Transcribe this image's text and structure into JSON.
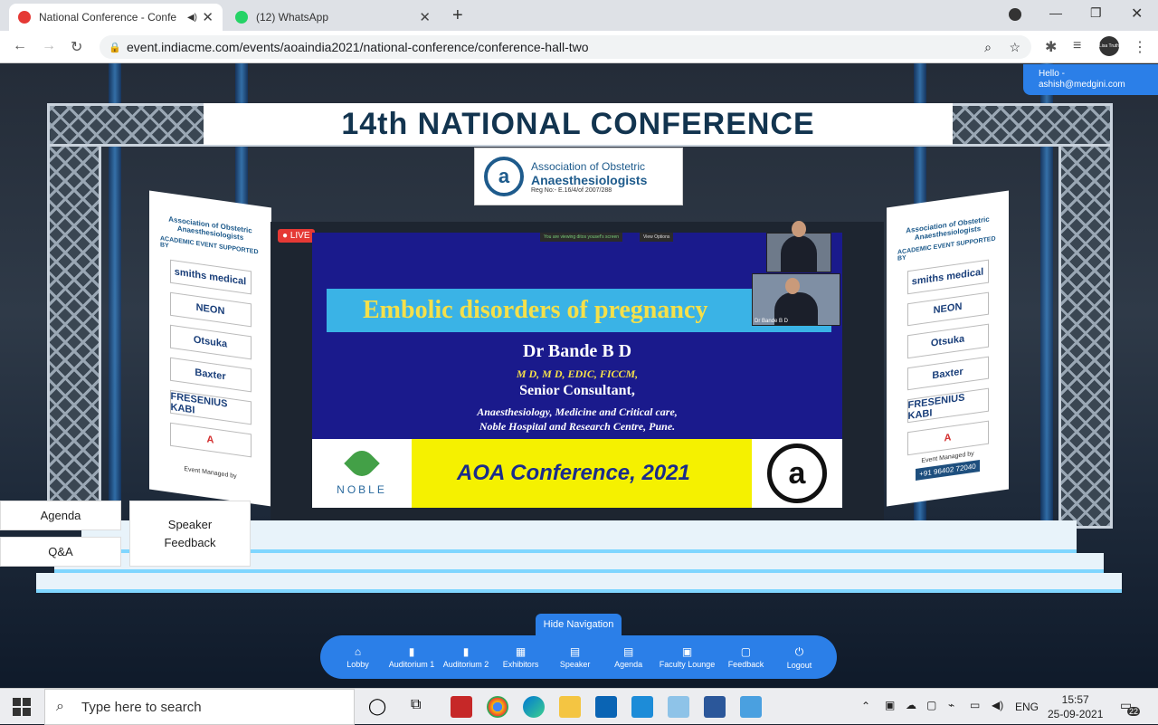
{
  "browser": {
    "tabs": [
      {
        "title": "National Conference - Confe",
        "active": true,
        "icon": "conference-favicon"
      },
      {
        "title": "(12) WhatsApp",
        "active": false,
        "icon": "whatsapp-favicon"
      }
    ],
    "url": "event.indiacme.com/events/aoaindia2021/national-conference/conference-hall-two",
    "profile_label": "Lisa Truth"
  },
  "user": {
    "greeting": "Hello -",
    "email": "ashish@medgini.com"
  },
  "stage": {
    "title": "14th NATIONAL CONFERENCE",
    "org": {
      "line1": "Association of Obstetric",
      "line2": "Anaesthesiologists",
      "line3": "Reg No:- E.16/4/of 2007/288",
      "logo_letter": "a"
    },
    "side_banner": {
      "org": "Association of Obstetric Anaesthesiologists",
      "supported": "ACADEMIC EVENT SUPPORTED BY",
      "sponsors": [
        "smiths medical",
        "NEON",
        "Otsuka",
        "Baxter",
        "FRESENIUS KABI",
        "A"
      ],
      "managed": "Event Managed by",
      "phone": "+91 96402 72040"
    }
  },
  "video": {
    "live_label": "LIVE",
    "share_notice": "You are viewing ditos yousef's screen",
    "view_options": "View Options",
    "cam_label": "Dr Bande B D",
    "slide": {
      "title": "Embolic disorders of pregnancy",
      "speaker": "Dr Bande B D",
      "degrees": "M D, M D, EDIC, FICCM,",
      "role": "Senior Consultant,",
      "dept_line1": "Anaesthesiology,  Medicine and Critical care,",
      "dept_line2": "Noble Hospital and Research Centre, Pune.",
      "hospital": "NOBLE",
      "conference": "AOA Conference, 2021",
      "logo_letter": "a"
    }
  },
  "side_buttons": {
    "agenda": "Agenda",
    "qa": "Q&A",
    "speaker_feedback_1": "Speaker",
    "speaker_feedback_2": "Feedback"
  },
  "navigation": {
    "toggle": "Hide Navigation",
    "items": [
      {
        "label": "Lobby",
        "icon": "home-icon"
      },
      {
        "label": "Auditorium 1",
        "icon": "door-icon"
      },
      {
        "label": "Auditorium 2",
        "icon": "door-icon"
      },
      {
        "label": "Exhibitors",
        "icon": "grid-icon"
      },
      {
        "label": "Speaker",
        "icon": "file-icon"
      },
      {
        "label": "Agenda",
        "icon": "file-icon"
      },
      {
        "label": "Faculty Lounge",
        "icon": "lounge-icon"
      },
      {
        "label": "Feedback",
        "icon": "feedback-icon"
      },
      {
        "label": "Logout",
        "icon": "power-icon"
      }
    ]
  },
  "taskbar": {
    "search_placeholder": "Type here to search",
    "language": "ENG",
    "time": "15:57",
    "date": "25-09-2021",
    "notifications": "22"
  },
  "colors": {
    "accent": "#2b7fe8",
    "title_text": "#12344f",
    "slide_bg": "#1a1a8c",
    "slide_title": "#f5e04a"
  }
}
